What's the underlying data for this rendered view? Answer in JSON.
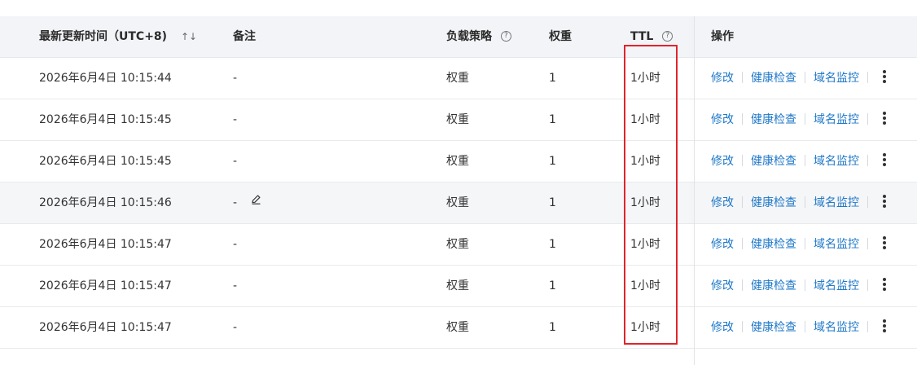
{
  "table": {
    "headers": {
      "time": "最新更新时间（UTC+8)",
      "sort_glyph": "↑↓",
      "note": "备注",
      "policy": "负载策略",
      "weight": "权重",
      "ttl": "TTL",
      "ops": "操作",
      "help_glyph": "?"
    },
    "rows": [
      {
        "time": "2026年6月4日 10:15:44",
        "note": "-",
        "policy": "权重",
        "weight": "1",
        "ttl": "1小时"
      },
      {
        "time": "2026年6月4日 10:15:45",
        "note": "-",
        "policy": "权重",
        "weight": "1",
        "ttl": "1小时"
      },
      {
        "time": "2026年6月4日 10:15:45",
        "note": "-",
        "policy": "权重",
        "weight": "1",
        "ttl": "1小时"
      },
      {
        "time": "2026年6月4日 10:15:46",
        "note": "-",
        "policy": "权重",
        "weight": "1",
        "ttl": "1小时"
      },
      {
        "time": "2026年6月4日 10:15:47",
        "note": "-",
        "policy": "权重",
        "weight": "1",
        "ttl": "1小时"
      },
      {
        "time": "2026年6月4日 10:15:47",
        "note": "-",
        "policy": "权重",
        "weight": "1",
        "ttl": "1小时"
      },
      {
        "time": "2026年6月4日 10:15:47",
        "note": "-",
        "policy": "权重",
        "weight": "1",
        "ttl": "1小时"
      }
    ],
    "actions": {
      "edit": "修改",
      "health_check": "健康检查",
      "domain_monitor": "域名监控"
    }
  },
  "icons": {
    "sort": "sort-icon",
    "help": "help-circle-icon",
    "edit_note": "pencil-icon",
    "more": "more-vertical-icon"
  },
  "colors": {
    "link": "#1f78c8",
    "header_bg": "#f2f4f7",
    "annotation_border": "#e0242b",
    "hover_row_bg": "#f5f6f8"
  }
}
